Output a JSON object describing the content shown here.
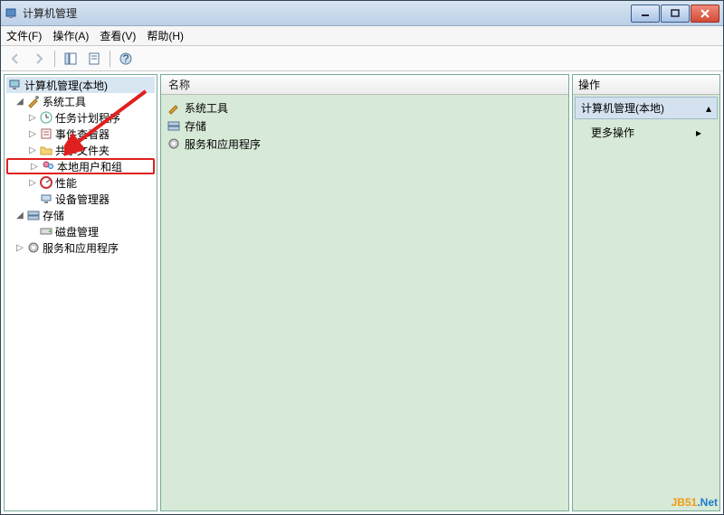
{
  "window": {
    "title": "计算机管理"
  },
  "menu": {
    "file": "文件(F)",
    "action": "操作(A)",
    "view": "查看(V)",
    "help": "帮助(H)"
  },
  "tree": {
    "root": "计算机管理(本地)",
    "system_tools": "系统工具",
    "task_scheduler": "任务计划程序",
    "event_viewer": "事件查看器",
    "shared_folders": "共享文件夹",
    "local_users_groups": "本地用户和组",
    "performance": "性能",
    "device_manager": "设备管理器",
    "storage": "存储",
    "disk_management": "磁盘管理",
    "services_apps": "服务和应用程序"
  },
  "center": {
    "col_name": "名称",
    "items": {
      "system_tools": "系统工具",
      "storage": "存储",
      "services_apps": "服务和应用程序"
    }
  },
  "right": {
    "header": "操作",
    "section": "计算机管理(本地)",
    "more": "更多操作"
  },
  "watermark": {
    "a": "JB51",
    "dot": ".",
    "b": "Net"
  }
}
